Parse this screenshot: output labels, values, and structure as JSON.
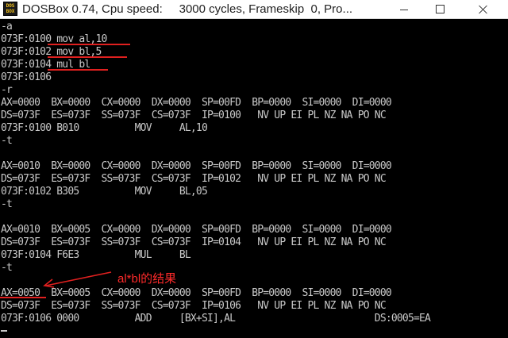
{
  "window": {
    "title": "DOSBox 0.74, Cpu speed:     3000 cycles, Frameskip  0, Pro...",
    "icon_text": "DOS BOX",
    "icon_name": "dosbox-icon",
    "buttons": {
      "minimize": "minimize-icon",
      "maximize": "maximize-icon",
      "close": "close-icon"
    }
  },
  "console": {
    "lines": [
      "-a",
      "073F:0100 mov al,10",
      "073F:0102 mov bl,5",
      "073F:0104 mul bl",
      "073F:0106",
      "-r",
      "AX=0000  BX=0000  CX=0000  DX=0000  SP=00FD  BP=0000  SI=0000  DI=0000",
      "DS=073F  ES=073F  SS=073F  CS=073F  IP=0100   NV UP EI PL NZ NA PO NC",
      "073F:0100 B010          MOV     AL,10",
      "-t",
      "",
      "AX=0010  BX=0000  CX=0000  DX=0000  SP=00FD  BP=0000  SI=0000  DI=0000",
      "DS=073F  ES=073F  SS=073F  CS=073F  IP=0102   NV UP EI PL NZ NA PO NC",
      "073F:0102 B305          MOV     BL,05",
      "-t",
      "",
      "AX=0010  BX=0005  CX=0000  DX=0000  SP=00FD  BP=0000  SI=0000  DI=0000",
      "DS=073F  ES=073F  SS=073F  CS=073F  IP=0104   NV UP EI PL NZ NA PO NC",
      "073F:0104 F6E3          MUL     BL",
      "-t",
      "",
      "AX=0050  BX=0005  CX=0000  DX=0000  SP=00FD  BP=0000  SI=0000  DI=0000",
      "DS=073F  ES=073F  SS=073F  CS=073F  IP=0106   NV UP EI PL NZ NA PO NC",
      "073F:0106 0000          ADD     [BX+SI],AL                         DS:0005=EA"
    ]
  },
  "annotation": {
    "text": "al*bl的结果",
    "color": "#ff2a2a"
  },
  "colors": {
    "console_bg": "#000000",
    "console_text": "#c8c8c8",
    "titlebar_bg": "#ffffff",
    "markup_red": "#e0201f"
  }
}
